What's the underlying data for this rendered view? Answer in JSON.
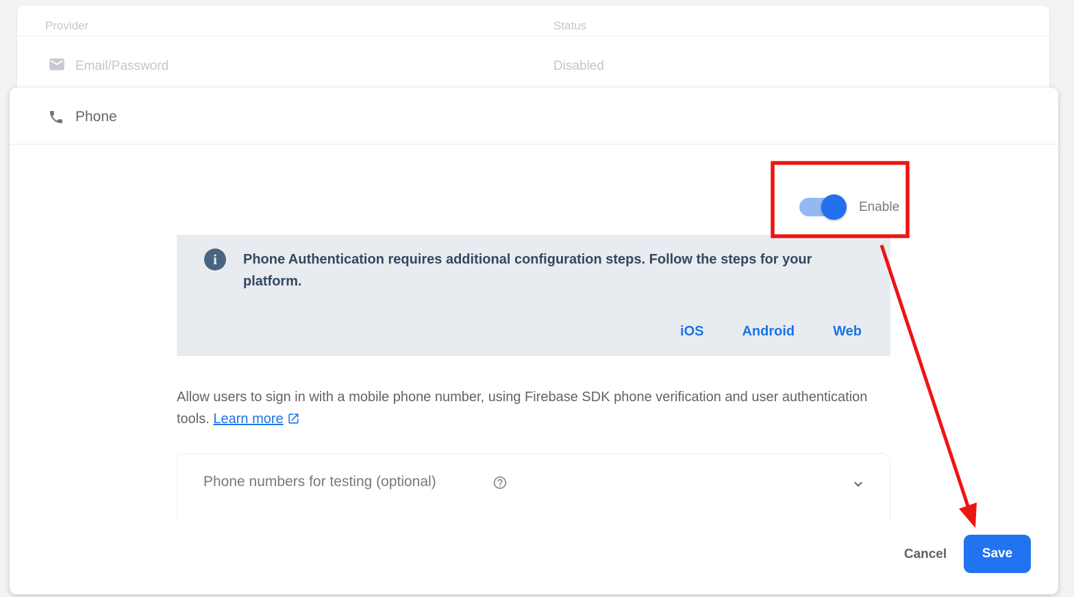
{
  "provider_table": {
    "columns": [
      "Provider",
      "Status"
    ],
    "rows": [
      {
        "provider": "Email/Password",
        "status": "Disabled",
        "icon": "email-icon"
      }
    ]
  },
  "dialog": {
    "title": "Phone",
    "icon": "phone-icon",
    "toggle": {
      "label": "Enable",
      "state": "on"
    },
    "banner": {
      "message": "Phone Authentication requires additional configuration steps. Follow the steps for your platform.",
      "links": [
        {
          "label": "iOS"
        },
        {
          "label": "Android"
        },
        {
          "label": "Web"
        }
      ]
    },
    "description": {
      "text": "Allow users to sign in with a mobile phone number, using Firebase SDK phone verification and user authentication tools.",
      "link_label": "Learn more"
    },
    "testing_section": {
      "title": "Phone numbers for testing (optional)"
    },
    "actions": {
      "cancel": "Cancel",
      "save": "Save"
    }
  },
  "annotation": {
    "color": "#ee1414",
    "highlight_target": "enable-toggle",
    "arrow_points_to": "save-button"
  },
  "colors": {
    "accent_blue": "#1a73e8",
    "save_button": "#2273f0",
    "toggle_track": "#93b8f3",
    "toggle_knob": "#2270ee",
    "banner_bg": "#e8ecf1",
    "banner_text": "#33485e",
    "page_bg": "#f1f3f5"
  }
}
